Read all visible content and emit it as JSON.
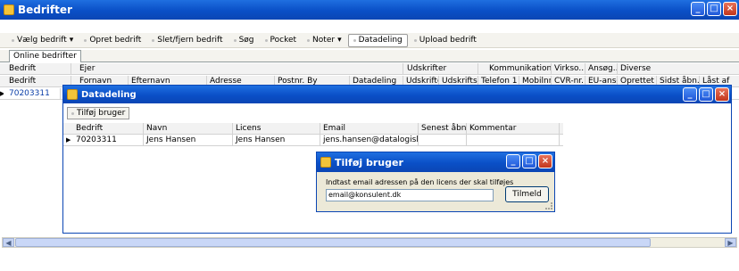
{
  "main": {
    "title": "Bedrifter",
    "toolbar": [
      {
        "label": "Vælg bedrift",
        "caret": "▾"
      },
      {
        "label": "Opret bedrift"
      },
      {
        "label": "Slet/fjern bedrift"
      },
      {
        "label": "Søg"
      },
      {
        "label": "Pocket"
      },
      {
        "label": "Noter",
        "caret": "▾"
      },
      {
        "label": "Datadeling",
        "active": true
      },
      {
        "label": "Upload bedrift"
      }
    ],
    "tab": "Online bedrifter",
    "group_header": {
      "bedrift": "Bedrift",
      "ejer": "Ejer",
      "udskrifter": "Udskrifter",
      "kommunikation": "Kommunikation",
      "virksomhed": "Virkso...",
      "ansoeg": "Ansøg...",
      "diverse": "Diverse"
    },
    "column_header": {
      "bedrift": "Bedrift",
      "fornavn": "Fornavn",
      "efternavn": "Efternavn",
      "adresse": "Adresse",
      "postnr": "Postnr. By",
      "datadeling": "Datadeling",
      "udskrifter": "Udskrifter",
      "udskriftsrum": "Udskriftsrum",
      "telefon": "Telefon 1",
      "mobil": "Mobilnr.",
      "cvr": "CVR-nr.",
      "eu": "EU-ansøg.",
      "oprettet": "Oprettet",
      "sidst": "Sidst åbn.",
      "last": "Låst af"
    },
    "row1": {
      "bedrift": "70203311"
    }
  },
  "datadeling": {
    "title": "Datadeling",
    "add_label": "Tilføj bruger",
    "columns": [
      "Bedrift",
      "Navn",
      "Licens",
      "Email",
      "Senest åbnet",
      "Kommentar"
    ],
    "rows": [
      {
        "bedrift": "70203311",
        "navn": "Jens Hansen",
        "licens": "Jens Hansen",
        "email": "jens.hansen@datalogisk.dk",
        "senest": "",
        "kommentar": ""
      }
    ]
  },
  "add_user": {
    "title": "Tilføj bruger",
    "instruction": "Indtast email adressen på den licens der skal tilføjes",
    "email": "email@konsulent.dk",
    "button": "Tilmeld"
  }
}
